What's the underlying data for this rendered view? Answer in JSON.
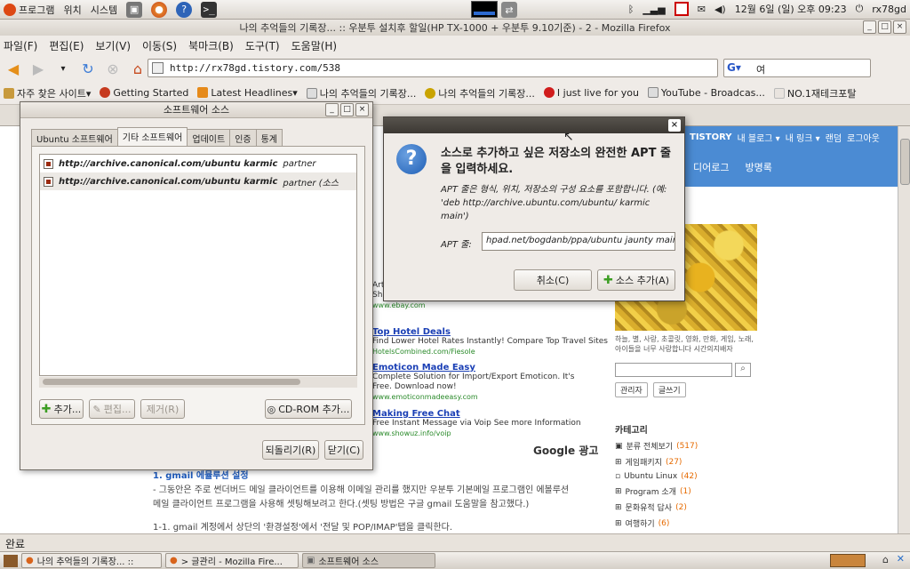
{
  "top_panel": {
    "menus": [
      "프로그램",
      "위치",
      "시스템"
    ],
    "date": "12월 6일 (일) 오후 09:23",
    "user": "rx78gd"
  },
  "firefox": {
    "title": "나의 추억들의 기록장... :: 우분투 설치후 할일(HP TX-1000 + 우분투 9.10기준) - 2 - Mozilla Firefox",
    "menu": [
      "파일(F)",
      "편집(E)",
      "보기(V)",
      "이동(S)",
      "북마크(B)",
      "도구(T)",
      "도움말(H)"
    ],
    "url": "http://rx78gd.tistory.com/538",
    "search_value": "여",
    "bookmarks": [
      "자주 찾은 사이트▾",
      "Getting Started",
      "Latest Headlines▾",
      "나의 추억들의 기록장...",
      "나의 추억들의 기록장...",
      "I just live for you",
      "YouTube - Broadcas...",
      "NO.1재테크포탈"
    ],
    "status": "완료"
  },
  "page": {
    "tistory_nav": [
      "TISTORY",
      "내 블로그 ▾",
      "내 링크 ▾",
      "랜덤",
      "로그아웃"
    ],
    "blue_links": [
      "디어로그",
      "방명록"
    ],
    "ads": [
      {
        "title": "Top Hotel Deals",
        "desc": "Find Lower Hotel Rates Instantly! Compare Top Travel Sites",
        "url": "HotelsCombined.com/Fiesole"
      },
      {
        "title": "Emoticon Made Easy",
        "desc": "Complete Solution for Import/Export Emoticon. It's Free. Download now!",
        "url": "www.emoticonmadeeasy.com"
      },
      {
        "title": "Making Free Chat",
        "desc": "Free Instant Message via Voip See more Information",
        "url": "www.showuz.info/voip"
      }
    ],
    "ad_partial": [
      "Art",
      "Shipping",
      "www.ebay.com"
    ],
    "google_ad": "Google 광고",
    "article_heading": "1. gmail 에뮬루션 설정",
    "article_line1": "- 그동안은 주로 썬더버드 메일 클라이언트를 이용해 이메일 관리를 했지만 우분투 기본메일 프로그램인 에볼루션",
    "article_line2": "메일 클라이언트 프로그램을 사용해 셋팅해보려고 한다.(셋팅 방법은 구글 gmail 도움말을 참고했다.)",
    "article_line3": "1-1. gmail 계정에서 상단의 '환경설정'에서 '전달 및 POP/IMAP'탭을 클릭한다.",
    "sidebar_caption": "하늘, 별, 사랑, 초콜릿, 영화, 만화, 게임, 노래, 아이들을 너무 사랑합니다 시간의지배자",
    "sidebar_buttons": [
      "관리자",
      "글쓰기"
    ],
    "category_title": "카테고리",
    "categories": [
      {
        "name": "분류 전체보기",
        "count": "(517)"
      },
      {
        "name": "게임패키지",
        "count": "(27)"
      },
      {
        "name": "Ubuntu Linux",
        "count": "(42)"
      },
      {
        "name": "Program 소개",
        "count": "(1)"
      },
      {
        "name": "문화유적 답사",
        "count": "(2)"
      },
      {
        "name": "여행하기",
        "count": "(6)"
      }
    ]
  },
  "software_sources": {
    "title": "소프트웨어 소스",
    "tabs": [
      "Ubuntu 소프트웨어",
      "기타 소프트웨어",
      "업데이트",
      "인증",
      "통계"
    ],
    "repos": [
      {
        "url": "http://archive.canonical.com/ubuntu karmic",
        "suffix": "partner"
      },
      {
        "url": "http://archive.canonical.com/ubuntu karmic",
        "suffix": "partner (소스"
      }
    ],
    "buttons": {
      "add": "추가...",
      "edit": "편집...",
      "remove": "제거(R)",
      "cdrom": "CD-ROM 추가...",
      "revert": "되돌리기(R)",
      "close": "닫기(C)"
    }
  },
  "apt_dialog": {
    "heading": "소스로 추가하고 싶은 저장소의 완전한 APT 줄을 입력하세요.",
    "desc": "APT 줄은 형식, 위치, 저장소의 구성 요소를 포함합니다. (예: 'deb http://archive.ubuntu.com/ubuntu/ karmic main')",
    "label": "APT 줄:",
    "value": "hpad.net/bogdanb/ppa/ubuntu jaunty main",
    "cancel": "취소(C)",
    "add": "소스 추가(A)"
  },
  "taskbar": [
    "나의 추억들의 기록장... ::",
    "> 글관리 - Mozilla Fire...",
    "소프트웨어 소스"
  ]
}
